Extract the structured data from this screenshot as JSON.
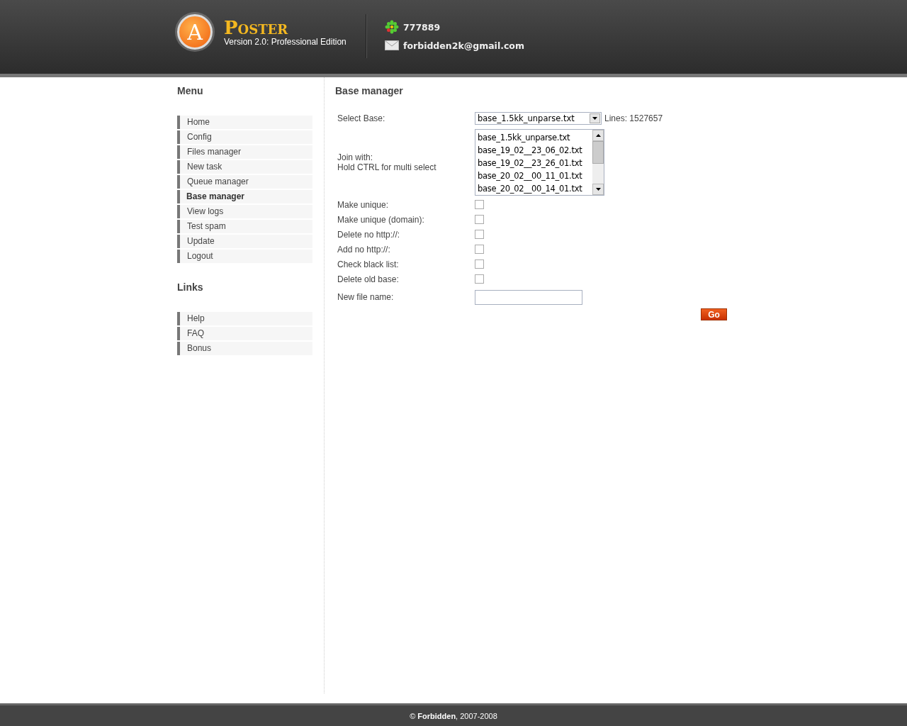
{
  "header": {
    "logo": {
      "letter": "A",
      "name": "Poster"
    },
    "version": "Version 2.0: Professional Edition",
    "icq": "777889",
    "email": "forbidden2k@gmail.com"
  },
  "sidebar": {
    "menu_title": "Menu",
    "menu": [
      {
        "label": "Home",
        "selected": false
      },
      {
        "label": "Config",
        "selected": false
      },
      {
        "label": "Files manager",
        "selected": false
      },
      {
        "label": "New task",
        "selected": false
      },
      {
        "label": "Queue manager",
        "selected": false
      },
      {
        "label": "Base manager",
        "selected": true
      },
      {
        "label": "View logs",
        "selected": false
      },
      {
        "label": "Test spam",
        "selected": false
      },
      {
        "label": "Update",
        "selected": false
      },
      {
        "label": "Logout",
        "selected": false
      }
    ],
    "links_title": "Links",
    "links": [
      {
        "label": "Help"
      },
      {
        "label": "FAQ"
      },
      {
        "label": "Bonus"
      }
    ]
  },
  "main": {
    "title": "Base manager",
    "select_base": {
      "label": "Select Base:",
      "value": "base_1.5kk_unparse.txt",
      "info": "Lines: 1527657"
    },
    "join_with": {
      "label": "Join with:",
      "hint": "Hold CTRL for multi select",
      "options": [
        {
          "label": "base_1.5kk_unparse.txt",
          "selected": false
        },
        {
          "label": "base_19_02__23_06_02.txt",
          "selected": false
        },
        {
          "label": "base_19_02__23_26_01.txt",
          "selected": false
        },
        {
          "label": "base_20_02__00_11_01.txt",
          "selected": false
        },
        {
          "label": "base_20_02__00_14_01.txt",
          "selected": false
        }
      ]
    },
    "options": [
      {
        "label": "Make unique:",
        "checked": false
      },
      {
        "label": "Make unique (domain):",
        "checked": false
      },
      {
        "label": "Delete no http://:",
        "checked": false
      },
      {
        "label": "Add no http://:",
        "checked": false
      },
      {
        "label": "Check black list:",
        "checked": false
      },
      {
        "label": "Delete old base:",
        "checked": false
      }
    ],
    "new_file_name": {
      "label": "New file name:"
    },
    "submit": "Go"
  },
  "footer": "© **Forbidden**, 2007-2008"
}
